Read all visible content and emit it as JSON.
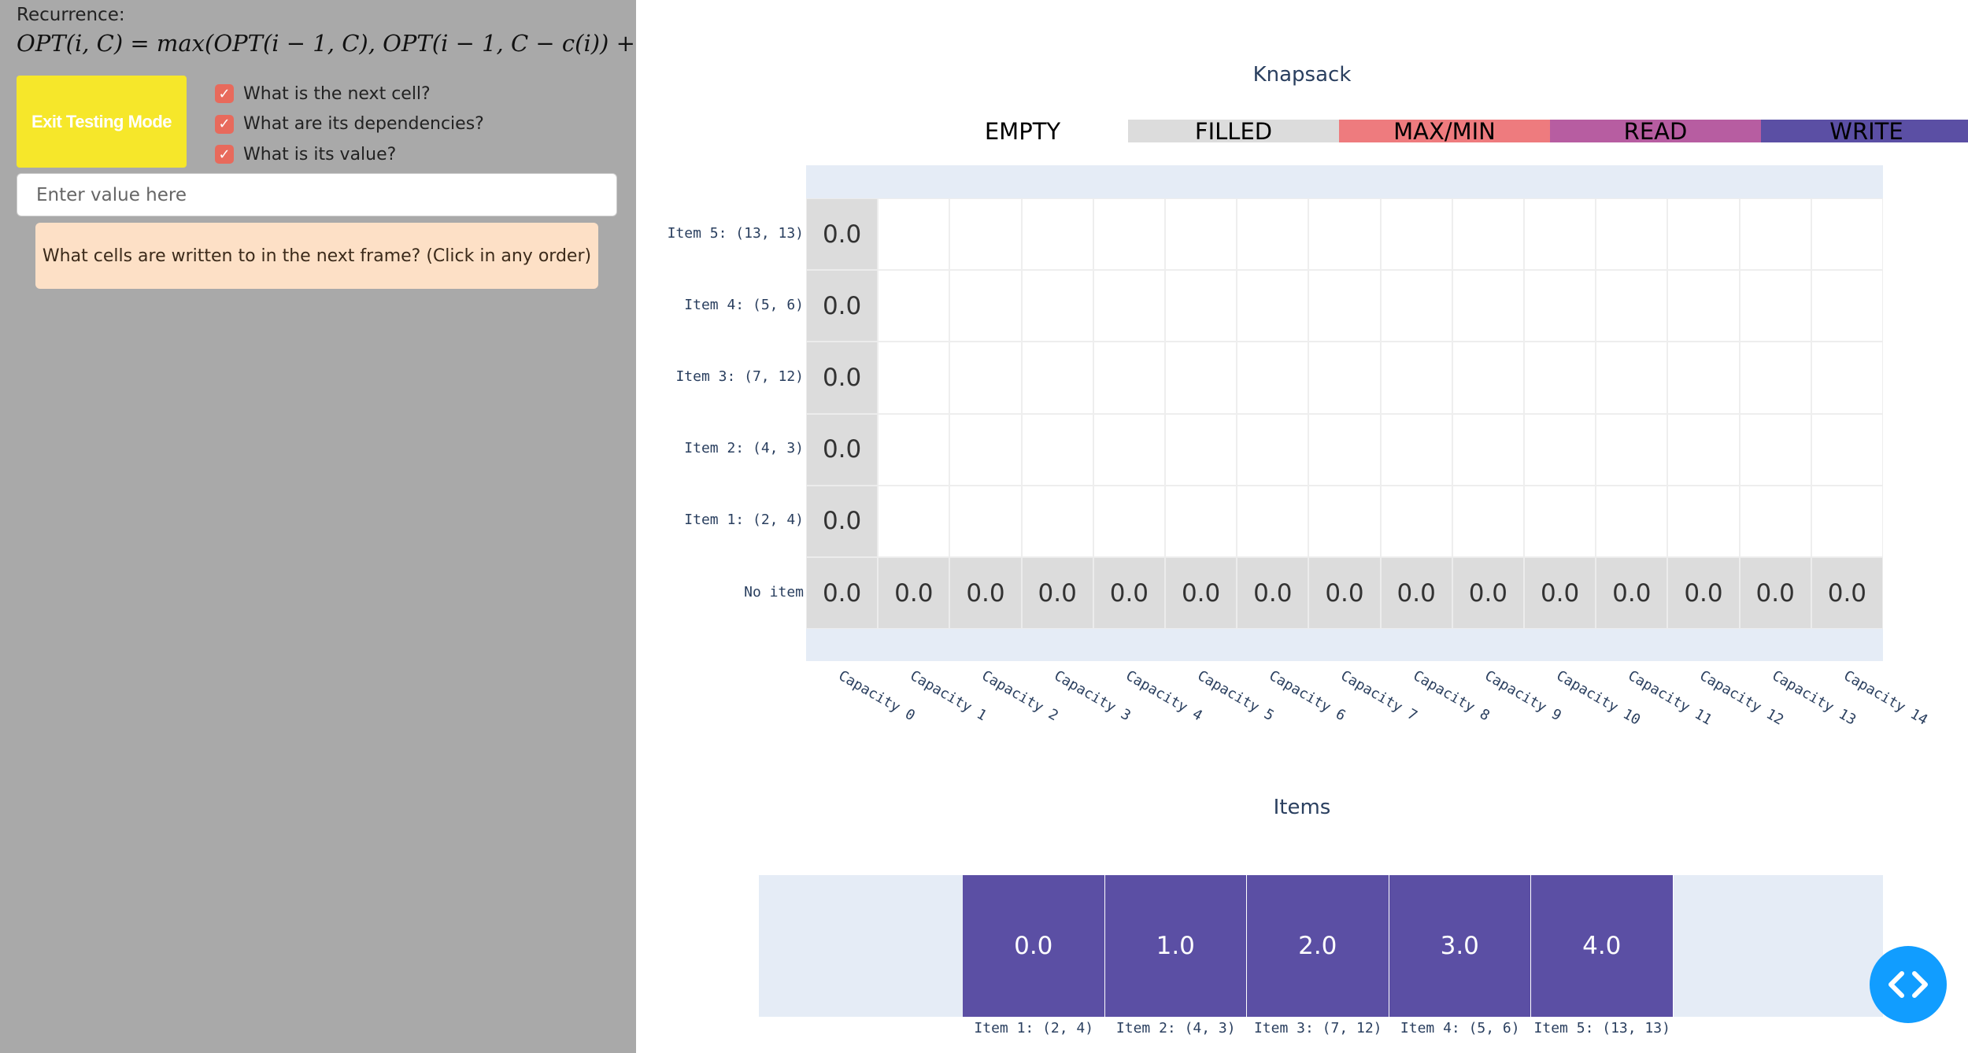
{
  "sidebar": {
    "recurrence_label": "Recurrence:",
    "recurrence_formula": "OPT(i, C) = max(OPT(i − 1, C), OPT(i − 1, C − c(i)) + v(i))",
    "exit_button": "Exit Testing Mode",
    "checks": [
      {
        "label": "What is the next cell?",
        "checked": true
      },
      {
        "label": "What are its dependencies?",
        "checked": true
      },
      {
        "label": "What is its value?",
        "checked": true
      }
    ],
    "input_placeholder": "Enter value here",
    "prompt": "What cells are written to in the next frame? (Click in any order)"
  },
  "knapsack": {
    "title": "Knapsack",
    "legend": [
      {
        "label": "EMPTY",
        "color": "#ffffff"
      },
      {
        "label": "FILLED",
        "color": "#dcdcdc"
      },
      {
        "label": "MAX/MIN",
        "color": "#ee7b7e"
      },
      {
        "label": "READ",
        "color": "#b75da1"
      },
      {
        "label": "WRITE",
        "color": "#5b4fa4"
      }
    ],
    "rows": [
      {
        "label": "Item 5: (13, 13)",
        "cells": [
          "0.0",
          "",
          "",
          "",
          "",
          "",
          "",
          "",
          "",
          "",
          "",
          "",
          "",
          "",
          ""
        ]
      },
      {
        "label": "Item 4: (5, 6)",
        "cells": [
          "0.0",
          "",
          "",
          "",
          "",
          "",
          "",
          "",
          "",
          "",
          "",
          "",
          "",
          "",
          ""
        ]
      },
      {
        "label": "Item 3: (7, 12)",
        "cells": [
          "0.0",
          "",
          "",
          "",
          "",
          "",
          "",
          "",
          "",
          "",
          "",
          "",
          "",
          "",
          ""
        ]
      },
      {
        "label": "Item 2: (4, 3)",
        "cells": [
          "0.0",
          "",
          "",
          "",
          "",
          "",
          "",
          "",
          "",
          "",
          "",
          "",
          "",
          "",
          ""
        ]
      },
      {
        "label": "Item 1: (2, 4)",
        "cells": [
          "0.0",
          "",
          "",
          "",
          "",
          "",
          "",
          "",
          "",
          "",
          "",
          "",
          "",
          "",
          ""
        ]
      },
      {
        "label": "No item",
        "cells": [
          "0.0",
          "0.0",
          "0.0",
          "0.0",
          "0.0",
          "0.0",
          "0.0",
          "0.0",
          "0.0",
          "0.0",
          "0.0",
          "0.0",
          "0.0",
          "0.0",
          "0.0"
        ]
      }
    ],
    "columns": [
      "Capacity 0",
      "Capacity 1",
      "Capacity 2",
      "Capacity 3",
      "Capacity 4",
      "Capacity 5",
      "Capacity 6",
      "Capacity 7",
      "Capacity 8",
      "Capacity 9",
      "Capacity 10",
      "Capacity 11",
      "Capacity 12",
      "Capacity 13",
      "Capacity 14"
    ]
  },
  "items": {
    "title": "Items",
    "cells": [
      {
        "value": "0.0",
        "label": "Item 1: (2, 4)"
      },
      {
        "value": "1.0",
        "label": "Item 2: (4, 3)"
      },
      {
        "value": "2.0",
        "label": "Item 3: (7, 12)"
      },
      {
        "value": "3.0",
        "label": "Item 4: (5, 6)"
      },
      {
        "value": "4.0",
        "label": "Item 5: (13, 13)"
      }
    ]
  },
  "fab": {
    "icon": "code-icon"
  }
}
